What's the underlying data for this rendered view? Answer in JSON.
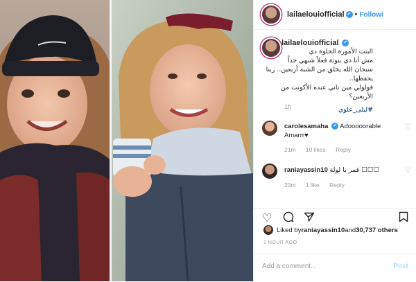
{
  "header": {
    "username": "lailaelouiofficial",
    "separator": "•",
    "follow_label": "Followi"
  },
  "caption": {
    "username": "lailaelouiofficial",
    "line1": "البنت الأمورة الحلوة دي",
    "line2": "مش أنا دي بنوتة فعلاً شبهي جداً",
    "line3": "سبحان الله يخلق من الشبه أربعين.. ربنا يحفظها..",
    "line4": "قولولي مين تاني عنده الأكونت من الأربعين؟",
    "hashtag": "#ليلى_علوي",
    "time": "1h"
  },
  "comments": [
    {
      "username": "carolesamaha",
      "text": "Adooooorable Amarrr♥",
      "time": "21m",
      "likes": "10 likes",
      "reply": "Reply"
    },
    {
      "username": "raniayassin10",
      "text": "قمر يا لولة ☐☐☐",
      "time": "23m",
      "likes": "1 like",
      "reply": "Reply"
    }
  ],
  "likes": {
    "prefix": "Liked by ",
    "user": "raniayassin10",
    "middle": " and ",
    "count": "30,737 others"
  },
  "time_ago": "1 HOUR AGO",
  "add_comment": {
    "placeholder": "Add a comment...",
    "post_label": "Post"
  },
  "icons": {
    "heart": "heart-icon",
    "comment": "comment-icon",
    "share": "share-icon",
    "bookmark": "bookmark-icon"
  }
}
